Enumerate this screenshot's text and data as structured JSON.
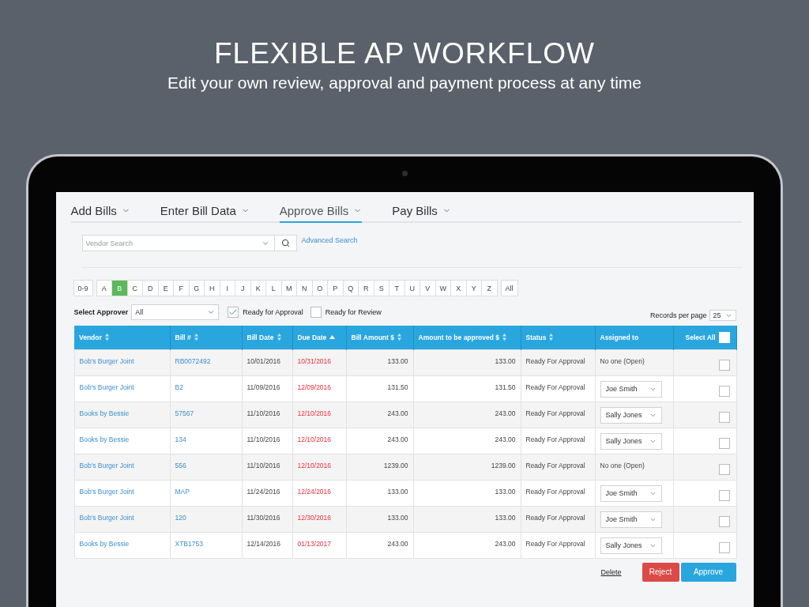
{
  "headline": "FLEXIBLE AP WORKFLOW",
  "subheadline": "Edit your own review, approval and payment process at any time",
  "tabs": [
    {
      "label": "Add Bills",
      "selected": false
    },
    {
      "label": "Enter Bill Data",
      "selected": false
    },
    {
      "label": "Approve Bills",
      "selected": true
    },
    {
      "label": "Pay Bills",
      "selected": false
    }
  ],
  "vendor_search": {
    "placeholder": "Vendor Search"
  },
  "advanced_search": "Advanced Search",
  "letters": [
    {
      "label": "0-9",
      "selected": false
    },
    {
      "label": "A",
      "selected": false
    },
    {
      "label": "B",
      "selected": true
    },
    {
      "label": "C",
      "selected": false
    },
    {
      "label": "D",
      "selected": false
    },
    {
      "label": "E",
      "selected": false
    },
    {
      "label": "F",
      "selected": false
    },
    {
      "label": "G",
      "selected": false
    },
    {
      "label": "H",
      "selected": false
    },
    {
      "label": "I",
      "selected": false
    },
    {
      "label": "J",
      "selected": false
    },
    {
      "label": "K",
      "selected": false
    },
    {
      "label": "L",
      "selected": false
    },
    {
      "label": "M",
      "selected": false
    },
    {
      "label": "N",
      "selected": false
    },
    {
      "label": "O",
      "selected": false
    },
    {
      "label": "P",
      "selected": false
    },
    {
      "label": "Q",
      "selected": false
    },
    {
      "label": "R",
      "selected": false
    },
    {
      "label": "S",
      "selected": false
    },
    {
      "label": "T",
      "selected": false
    },
    {
      "label": "U",
      "selected": false
    },
    {
      "label": "V",
      "selected": false
    },
    {
      "label": "W",
      "selected": false
    },
    {
      "label": "X",
      "selected": false
    },
    {
      "label": "Y",
      "selected": false
    },
    {
      "label": "Z",
      "selected": false
    },
    {
      "label": "All",
      "selected": false
    }
  ],
  "approver": {
    "label": "Select Approver",
    "value": "All"
  },
  "filters": [
    {
      "label": "Ready for Approval",
      "checked": true
    },
    {
      "label": "Ready for Review",
      "checked": false
    }
  ],
  "records_per_page": {
    "label": "Records per page",
    "value": "25"
  },
  "table": {
    "columns": [
      {
        "label": "Vendor",
        "sortable": true,
        "sorted_ascending": false
      },
      {
        "label": "Bill #",
        "sortable": true,
        "sorted_ascending": false
      },
      {
        "label": "Bill Date",
        "sortable": true,
        "sorted_ascending": false
      },
      {
        "label": "Due Date",
        "sortable": true,
        "sorted_ascending": true
      },
      {
        "label": "Bill Amount $",
        "sortable": true,
        "sorted_ascending": false
      },
      {
        "label": "Amount to be approved $",
        "sortable": true,
        "sorted_ascending": false
      },
      {
        "label": "Status",
        "sortable": true,
        "sorted_ascending": false
      },
      {
        "label": "Assigned to",
        "sortable": false,
        "sorted_ascending": false
      }
    ],
    "select_all": {
      "label": "Select All",
      "checked": false
    },
    "rows": [
      {
        "vendor": "Bob's Burger Joint",
        "bill": "RB0072492",
        "bill_date": "10/01/2016",
        "due_date": "10/31/2016",
        "bill_amount": "133.00",
        "amount_to_approve": "133.00",
        "status": "Ready For Approval",
        "assigned": {
          "kind": "text",
          "value": "No one (Open)"
        },
        "checked": false
      },
      {
        "vendor": "Bob's Burger Joint",
        "bill": "B2",
        "bill_date": "11/09/2016",
        "due_date": "12/09/2016",
        "bill_amount": "131.50",
        "amount_to_approve": "131.50",
        "status": "Ready For Approval",
        "assigned": {
          "kind": "select",
          "value": "Joe Smith"
        },
        "checked": false
      },
      {
        "vendor": "Books by Bessie",
        "bill": "57567",
        "bill_date": "11/10/2016",
        "due_date": "12/10/2016",
        "bill_amount": "243.00",
        "amount_to_approve": "243.00",
        "status": "Ready For Approval",
        "assigned": {
          "kind": "select",
          "value": "Sally Jones"
        },
        "checked": false
      },
      {
        "vendor": "Books by Bessie",
        "bill": "134",
        "bill_date": "11/10/2016",
        "due_date": "12/10/2016",
        "bill_amount": "243.00",
        "amount_to_approve": "243.00",
        "status": "Ready For Approval",
        "assigned": {
          "kind": "select",
          "value": "Sally Jones"
        },
        "checked": false
      },
      {
        "vendor": "Bob's Burger Joint",
        "bill": "556",
        "bill_date": "11/10/2016",
        "due_date": "12/10/2016",
        "bill_amount": "1239.00",
        "amount_to_approve": "1239.00",
        "status": "Ready For Approval",
        "assigned": {
          "kind": "text",
          "value": "No one (Open)"
        },
        "checked": false
      },
      {
        "vendor": "Bob's Burger Joint",
        "bill": "MAP",
        "bill_date": "11/24/2016",
        "due_date": "12/24/2016",
        "bill_amount": "133.00",
        "amount_to_approve": "133.00",
        "status": "Ready For Approval",
        "assigned": {
          "kind": "select",
          "value": "Joe Smith"
        },
        "checked": false
      },
      {
        "vendor": "Bob's Burger Joint",
        "bill": "120",
        "bill_date": "11/30/2016",
        "due_date": "12/30/2016",
        "bill_amount": "133.00",
        "amount_to_approve": "133.00",
        "status": "Ready For Approval",
        "assigned": {
          "kind": "select",
          "value": "Joe Smith"
        },
        "checked": false
      },
      {
        "vendor": "Books by Bessie",
        "bill": "XTB1753",
        "bill_date": "12/14/2016",
        "due_date": "01/13/2017",
        "bill_amount": "243.00",
        "amount_to_approve": "243.00",
        "status": "Ready For Approval",
        "assigned": {
          "kind": "select",
          "value": "Sally Jones"
        },
        "checked": false
      }
    ]
  },
  "actions": {
    "delete": "Delete",
    "reject": "Reject",
    "approve": "Approve"
  }
}
